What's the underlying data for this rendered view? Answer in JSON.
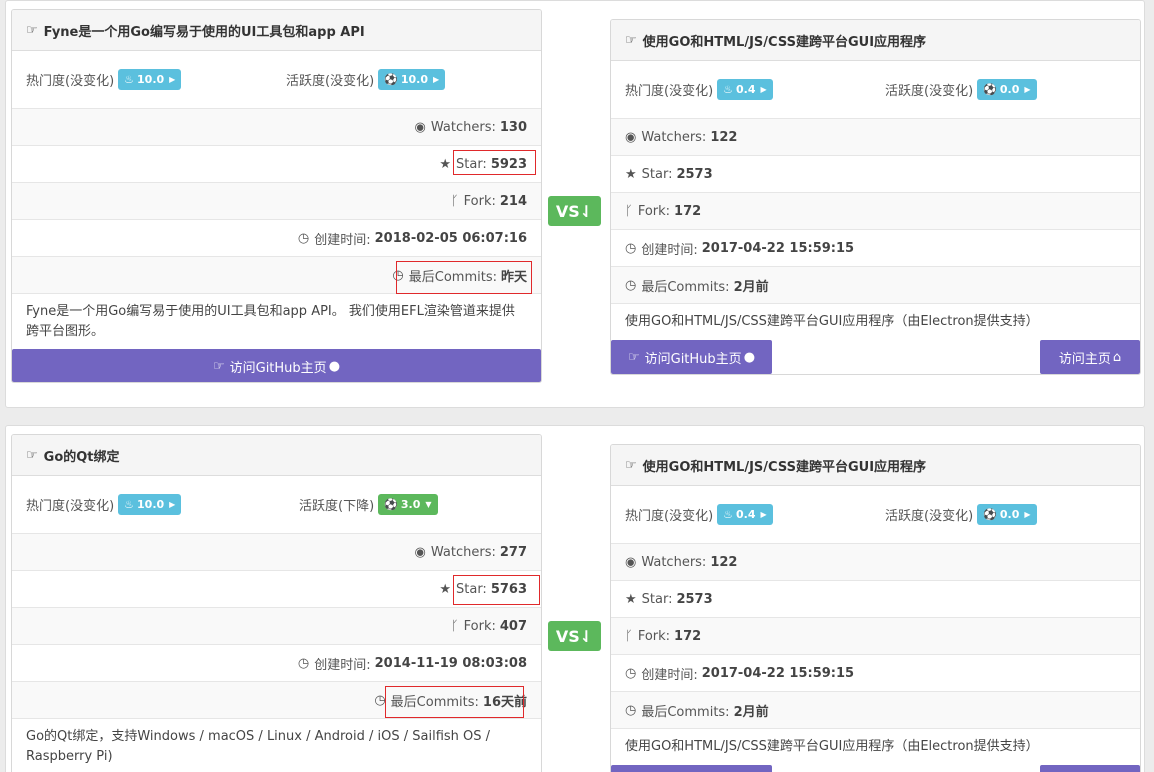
{
  "common": {
    "hot_label": "热门度(没变化)",
    "vs_label": "VS⇃",
    "watchers_label": "Watchers:",
    "star_label": "Star:",
    "fork_label": "Fork:",
    "created_label": "创建时间:",
    "commits_label": "最后Commits:",
    "github_button": "访问GitHub主页",
    "home_button": "访问主页"
  },
  "comparisons": [
    {
      "left": {
        "title": "Fyne是一个用Go编写易于使用的UI工具包和app API",
        "hot_value": "10.0",
        "activity_label": "活跃度(没变化)",
        "activity_value": "10.0",
        "watchers": "130",
        "star": "5923",
        "fork": "214",
        "created": "2018-02-05 06:07:16",
        "commits": "昨天",
        "description": "Fyne是一个用Go编写易于使用的UI工具包和app API。 我们使用EFL渲染管道来提供跨平台图形。"
      },
      "right": {
        "title": "使用GO和HTML/JS/CSS建跨平台GUI应用程序",
        "hot_value": "0.4",
        "activity_label": "活跃度(没变化)",
        "activity_value": "0.0",
        "watchers": "122",
        "star": "2573",
        "fork": "172",
        "created": "2017-04-22 15:59:15",
        "commits": "2月前",
        "description": "使用GO和HTML/JS/CSS建跨平台GUI应用程序（由Electron提供支持）"
      }
    },
    {
      "left": {
        "title": "Go的Qt绑定",
        "hot_value": "10.0",
        "activity_label": "活跃度(下降)",
        "activity_value": "3.0",
        "watchers": "277",
        "star": "5763",
        "fork": "407",
        "created": "2014-11-19 08:03:08",
        "commits": "16天前",
        "description": "Go的Qt绑定，支持Windows / macOS / Linux / Android / iOS / Sailfish OS / Raspberry Pi)"
      },
      "right": {
        "title": "使用GO和HTML/JS/CSS建跨平台GUI应用程序",
        "hot_value": "0.4",
        "activity_label": "活跃度(没变化)",
        "activity_value": "0.0",
        "watchers": "122",
        "star": "2573",
        "fork": "172",
        "created": "2017-04-22 15:59:15",
        "commits": "2月前",
        "description": "使用GO和HTML/JS/CSS建跨平台GUI应用程序（由Electron提供支持）"
      }
    }
  ],
  "icons": {
    "thumbs": "thumbs-up-icon",
    "fire": "fire-icon",
    "soccer": "soccer-ball-icon",
    "eye": "eye-icon",
    "star": "star-icon",
    "fork": "fork-icon",
    "clock": "clock-icon",
    "github": "github-icon",
    "home": "home-icon"
  },
  "colors": {
    "info": "#5bc0de",
    "success": "#5cb85c",
    "button": "#7265c1",
    "highlight": "#e0292b"
  }
}
